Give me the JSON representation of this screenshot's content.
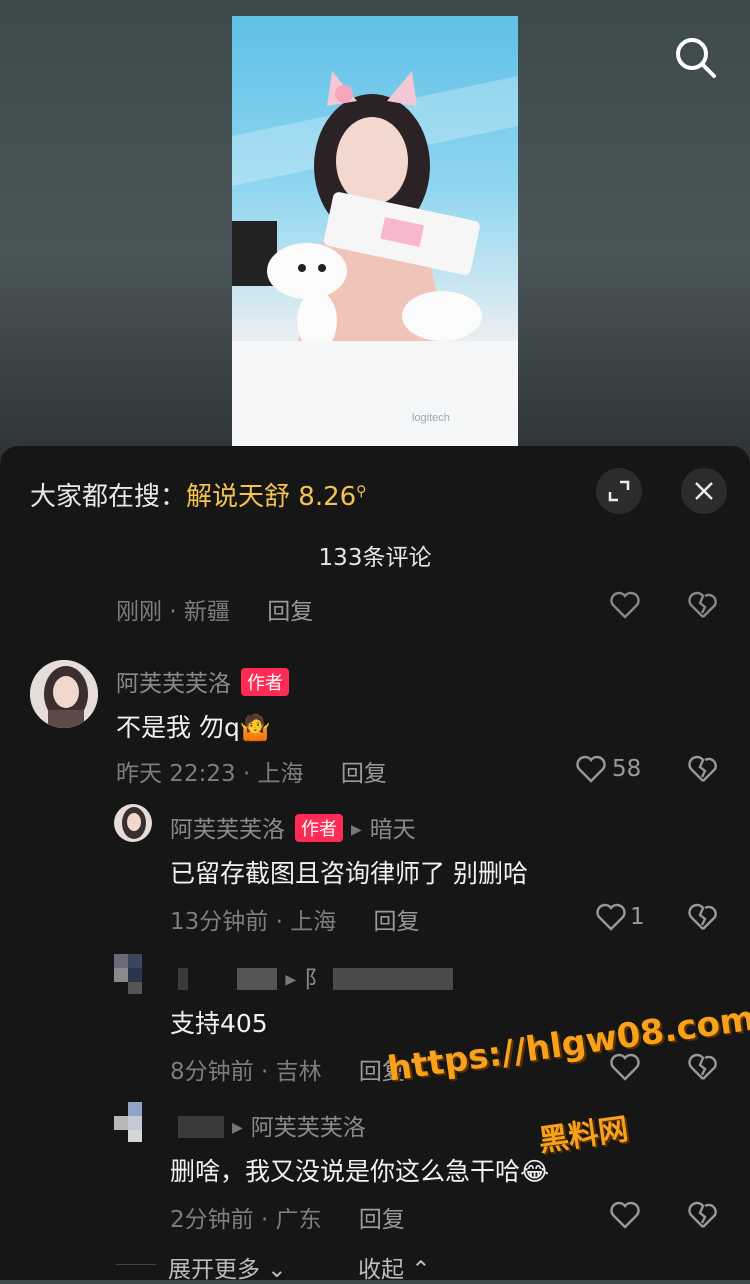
{
  "search": {
    "icon": "search-icon"
  },
  "trending": {
    "prefix": "大家都在搜：",
    "term": "解说天舒 8.26",
    "icon": "search-small-icon"
  },
  "header": {
    "count_label": "133条评论"
  },
  "controls": {
    "expand_icon": "expand-icon",
    "close_icon": "close-icon"
  },
  "comments": [
    {
      "meta_time": "刚刚 · 新疆",
      "reply_label": "回复"
    },
    {
      "user": "阿芙芙芙洛",
      "tag": "作者",
      "text": "不是我 勿q🤷",
      "meta_time": "昨天 22:23 · 上海",
      "reply_label": "回复",
      "likes": "58"
    }
  ],
  "replies": [
    {
      "user": "阿芙芙芙洛",
      "tag": "作者",
      "reply_to": "暗天",
      "text": "已留存截图且咨询律师了 别删哈",
      "meta_time": "13分钟前 · 上海",
      "reply_label": "回复",
      "likes": "1"
    },
    {
      "user": "",
      "reply_to": "阝",
      "text": "支持405",
      "meta_time": "8分钟前 · 吉林",
      "reply_label": "回复"
    },
    {
      "user": "",
      "reply_to": "阿芙芙芙洛",
      "text": "删啥，我又没说是你这么急干哈😂",
      "meta_time": "2分钟前 · 广东",
      "reply_label": "回复"
    }
  ],
  "footer": {
    "expand_more": "展开更多",
    "collapse": "收起"
  },
  "watermark": {
    "url": "https://hlgw08.com",
    "brand": "黑料网"
  },
  "colors": {
    "accent": "#fe2c55",
    "trend": "#f3c24f",
    "sheet": "#161616"
  }
}
